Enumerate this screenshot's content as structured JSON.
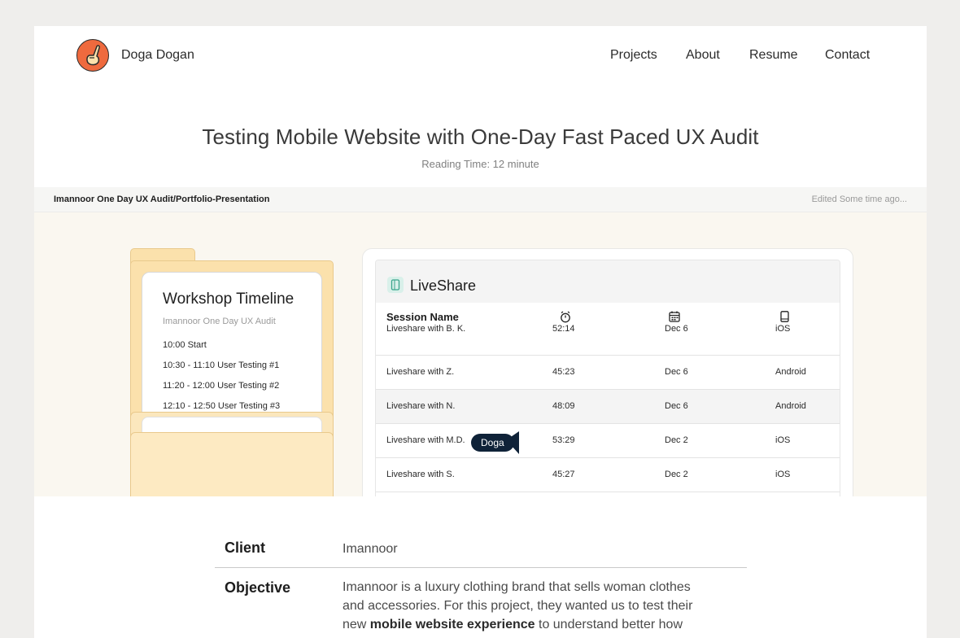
{
  "header": {
    "brand_name": "Doga Dogan",
    "nav": [
      "Projects",
      "About",
      "Resume",
      "Contact"
    ]
  },
  "article": {
    "title": "Testing Mobile Website with One-Day Fast Paced UX Audit",
    "reading_time": "Reading Time: 12 minute"
  },
  "embed": {
    "file_name": "Imannoor One Day UX Audit/Portfolio-Presentation",
    "edited": "Edited Some time ago..."
  },
  "timeline": {
    "title": "Workshop Timeline",
    "subtitle": "Imannoor One Day UX Audit",
    "items": [
      "10:00 Start",
      "10:30 - 11:10 User Testing #1",
      "11:20 - 12:00 User Testing #2",
      "12:10 - 12:50 User Testing #3"
    ]
  },
  "liveshare": {
    "title": "LiveShare",
    "col_session": "Session Name",
    "icons": [
      "timer-icon",
      "calendar-icon",
      "phone-icon"
    ],
    "rows": [
      [
        "Liveshare with B. K.",
        "52:14",
        "Dec 6",
        "iOS"
      ],
      [
        "Liveshare with Z.",
        "45:23",
        "Dec 6",
        "Android"
      ],
      [
        "Liveshare with N.",
        "48:09",
        "Dec 6",
        "Android"
      ],
      [
        "Liveshare with M.D.",
        "53:29",
        "Dec 2",
        "iOS"
      ],
      [
        "Liveshare with S.",
        "45:27",
        "Dec 2",
        "iOS"
      ]
    ],
    "cursor_label": "Doga"
  },
  "details": {
    "client_label": "Client",
    "client_value": "Imannoor",
    "objective_label": "Objective",
    "objective_pre": "Imannoor is a luxury clothing brand that sells woman clothes and accessories. For this project, they wanted us to test their new ",
    "objective_bold": "mobile website experience",
    "objective_post": " to understand better how users"
  },
  "colors": {
    "accent": "#ef6a3e",
    "folder": "#fbe1ac",
    "cursor": "#0f2238"
  }
}
